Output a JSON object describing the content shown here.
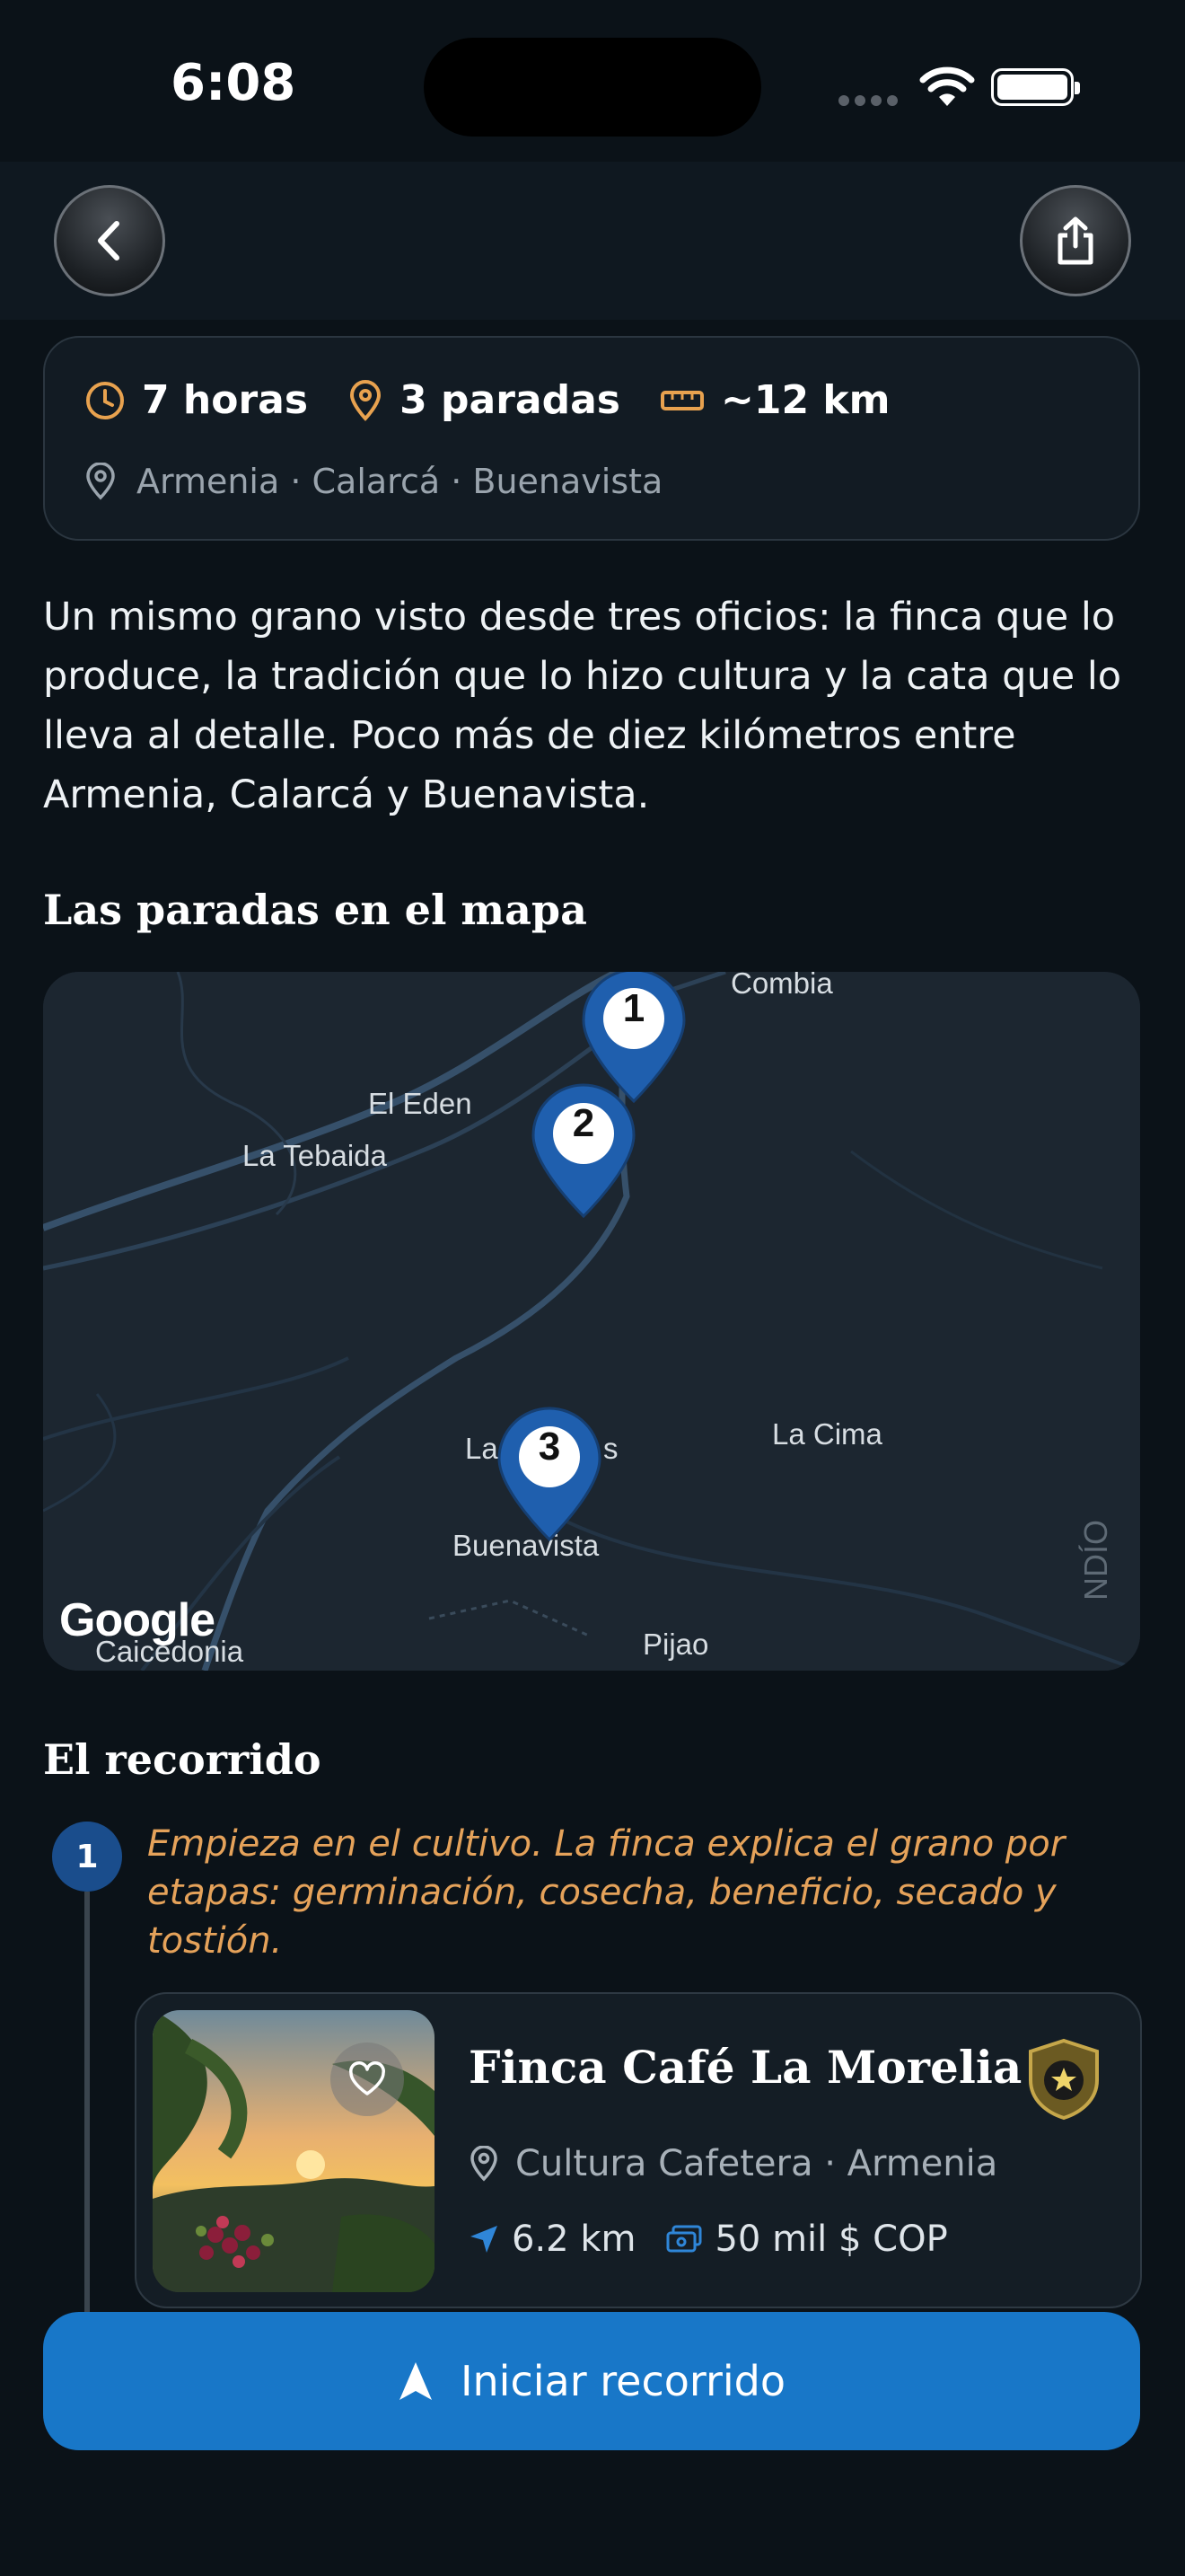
{
  "status_bar": {
    "time": "6:08"
  },
  "header": {
    "back_icon": "chevron-left-icon",
    "share_icon": "share-icon"
  },
  "summary": {
    "duration": "7 horas",
    "stops": "3 paradas",
    "distance": "~12 km",
    "towns": "Armenia · Calarcá · Buenavista"
  },
  "description": "Un mismo grano visto desde tres oficios: la finca que lo produce, la tradición que lo hizo cultura y la cata que lo lleva al detalle. Poco más de diez kilómetros entre Armenia, Calarcá y Buenavista.",
  "map_section": {
    "title": "Las paradas en el mapa",
    "labels": {
      "cordoba": "Combia",
      "el_eden": "El Eden",
      "la_tebaida": "La Tebaida",
      "la_cima": "La Cima",
      "buenavista": "Buenavista",
      "pijao": "Pijao",
      "caicedonia": "Caicedonia",
      "la_s_left": "La",
      "la_s_right": "s",
      "department": "NDÍO",
      "google": "Google"
    },
    "pins": [
      "1",
      "2",
      "3"
    ]
  },
  "route_section": {
    "title": "El recorrido",
    "steps": [
      {
        "number": "1",
        "text": "Empieza en el cultivo. La finca explica el grano por etapas: germinación, cosecha, beneficio, secado y tostión.",
        "place": {
          "name": "Finca Café La Morelia",
          "category": "Cultura Cafetera · Armenia",
          "distance": "6.2 km",
          "price": "50 mil $ COP"
        }
      }
    ]
  },
  "cta": {
    "label": "Iniciar recorrido"
  },
  "colors": {
    "accent": "#1877c8",
    "italic_text": "#e5a25a",
    "pin": "#1f5fae",
    "background": "#0b1218"
  }
}
